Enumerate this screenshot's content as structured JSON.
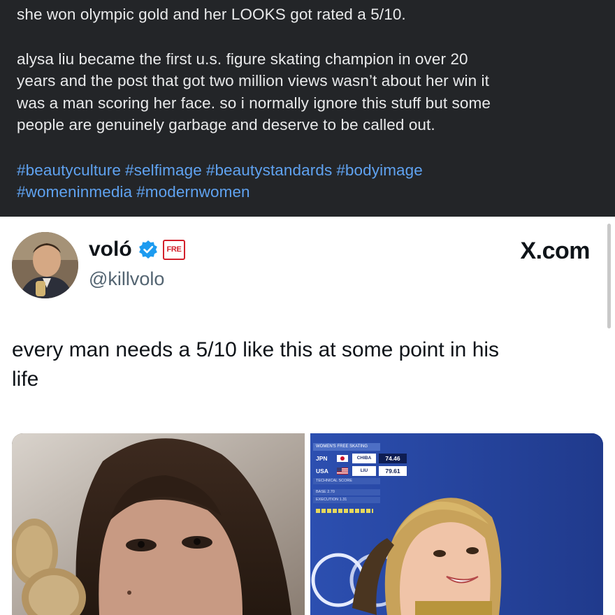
{
  "caption": {
    "headline": "she won olympic gold and her LOOKS got rated a 5/10.",
    "body_lines": [
      "alysa liu became the first u.s. figure skating champion in over 20",
      "years and the post that got two million views wasn’t about her win it",
      "was a man scoring her face. so i normally ignore this stuff but some",
      "people are genuinely garbage and deserve to be called out."
    ],
    "hashtags_line1": [
      "#beautyculture",
      "#selfimage",
      "#beautystandards",
      "#bodyimage"
    ],
    "hashtags_line2": [
      "#womeninmedia",
      "#modernwomen"
    ],
    "colors": {
      "background": "#232528",
      "text": "#e9eaeb",
      "hashtag": "#5fa2f0"
    }
  },
  "tweet": {
    "display_name": "voló",
    "handle": "@killvolo",
    "badge_text": "FRE",
    "site": "X.com",
    "text_line1": "every man needs a 5/10 like this at some point in his",
    "text_line2": "life",
    "verified_icon": "verified-check-icon",
    "colors": {
      "verified": "#1d9bf0",
      "badge": "#d3202b",
      "handle": "#536471"
    }
  },
  "media": {
    "scoreboard": {
      "header": "WOMEN'S FREE SKATING",
      "rows": [
        {
          "country": "JPN",
          "name": "CHIBA",
          "score": "74.46"
        },
        {
          "country": "USA",
          "name": "LIU",
          "score": "79.61"
        }
      ],
      "sub_label": "TECHNICAL SCORE",
      "base": "BASE 2.70",
      "execution": "EXECUTION 1.31"
    }
  }
}
